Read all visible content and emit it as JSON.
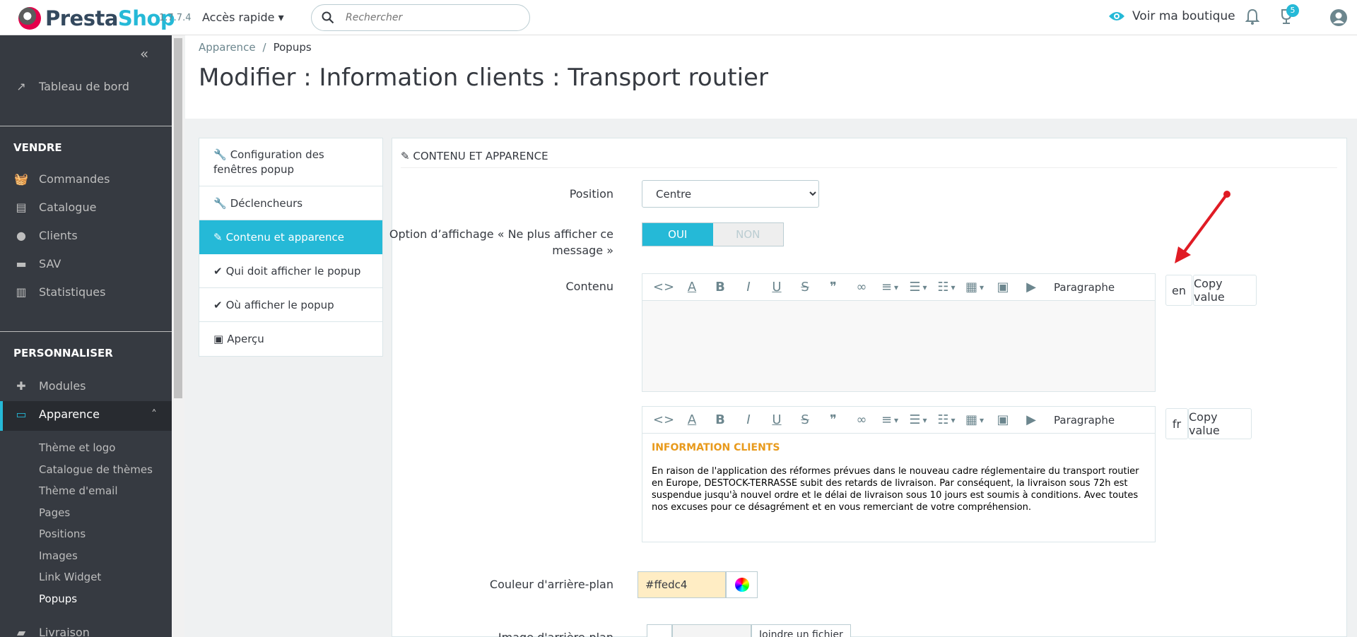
{
  "header": {
    "brand_pre": "Presta",
    "brand_post": "Shop",
    "version": "1.7.7.4",
    "quick_access": "Accès rapide",
    "search_placeholder": "Rechercher",
    "view_shop": "Voir ma boutique",
    "notif_count": "5"
  },
  "sidebar": {
    "dashboard": "Tableau de bord",
    "section_sell": "VENDRE",
    "sell_items": [
      "Commandes",
      "Catalogue",
      "Clients",
      "SAV",
      "Statistiques"
    ],
    "section_custom": "PERSONNALISER",
    "custom_items": [
      "Modules",
      "Apparence"
    ],
    "appearance_sub": [
      "Thème et logo",
      "Catalogue de thèmes",
      "Thème d'email",
      "Pages",
      "Positions",
      "Images",
      "Link Widget",
      "Popups"
    ],
    "shipping": "Livraison"
  },
  "breadcrumb": {
    "parent": "Apparence",
    "current": "Popups"
  },
  "page_title": "Modifier : Information clients : Transport routier",
  "tabs": [
    "Configuration des fenêtres popup",
    "Déclencheurs",
    "Contenu et apparence",
    "Qui doit afficher le popup",
    "Où afficher le popup",
    "Aperçu"
  ],
  "panel": {
    "title": "CONTENU ET APPARENCE",
    "position_label": "Position",
    "position_value": "Centre",
    "option_label": "Option d’affichage « Ne plus afficher ce message »",
    "toggle_on": "OUI",
    "toggle_off": "NON",
    "content_label": "Contenu",
    "paragraph": "Paragraphe",
    "lang_en": "en",
    "lang_fr": "fr",
    "copy_value": "Copy value",
    "content_title": "INFORMATION CLIENTS",
    "content_text": "En raison de l'application des réformes prévues dans le nouveau cadre réglementaire du transport routier en Europe, DESTOCK-TERRASSE subit des retards de livraison. Par conséquent, la livraison sous 72h est suspendue jusqu'à nouvel ordre et le délai de livraison sous 10 jours est soumis à conditions. Avec toutes nos excuses pour ce désagrément et en vous remerciant de votre compréhension.",
    "bg_color_label": "Couleur d'arrière-plan",
    "bg_color_value": "#ffedc4",
    "bg_image_label": "Image d'arrière-plan",
    "attach_file": "Joindre un fichier"
  },
  "colors": {
    "accent": "#25b9d7",
    "sidebar": "#363a41",
    "arrow": "#e01b24"
  }
}
